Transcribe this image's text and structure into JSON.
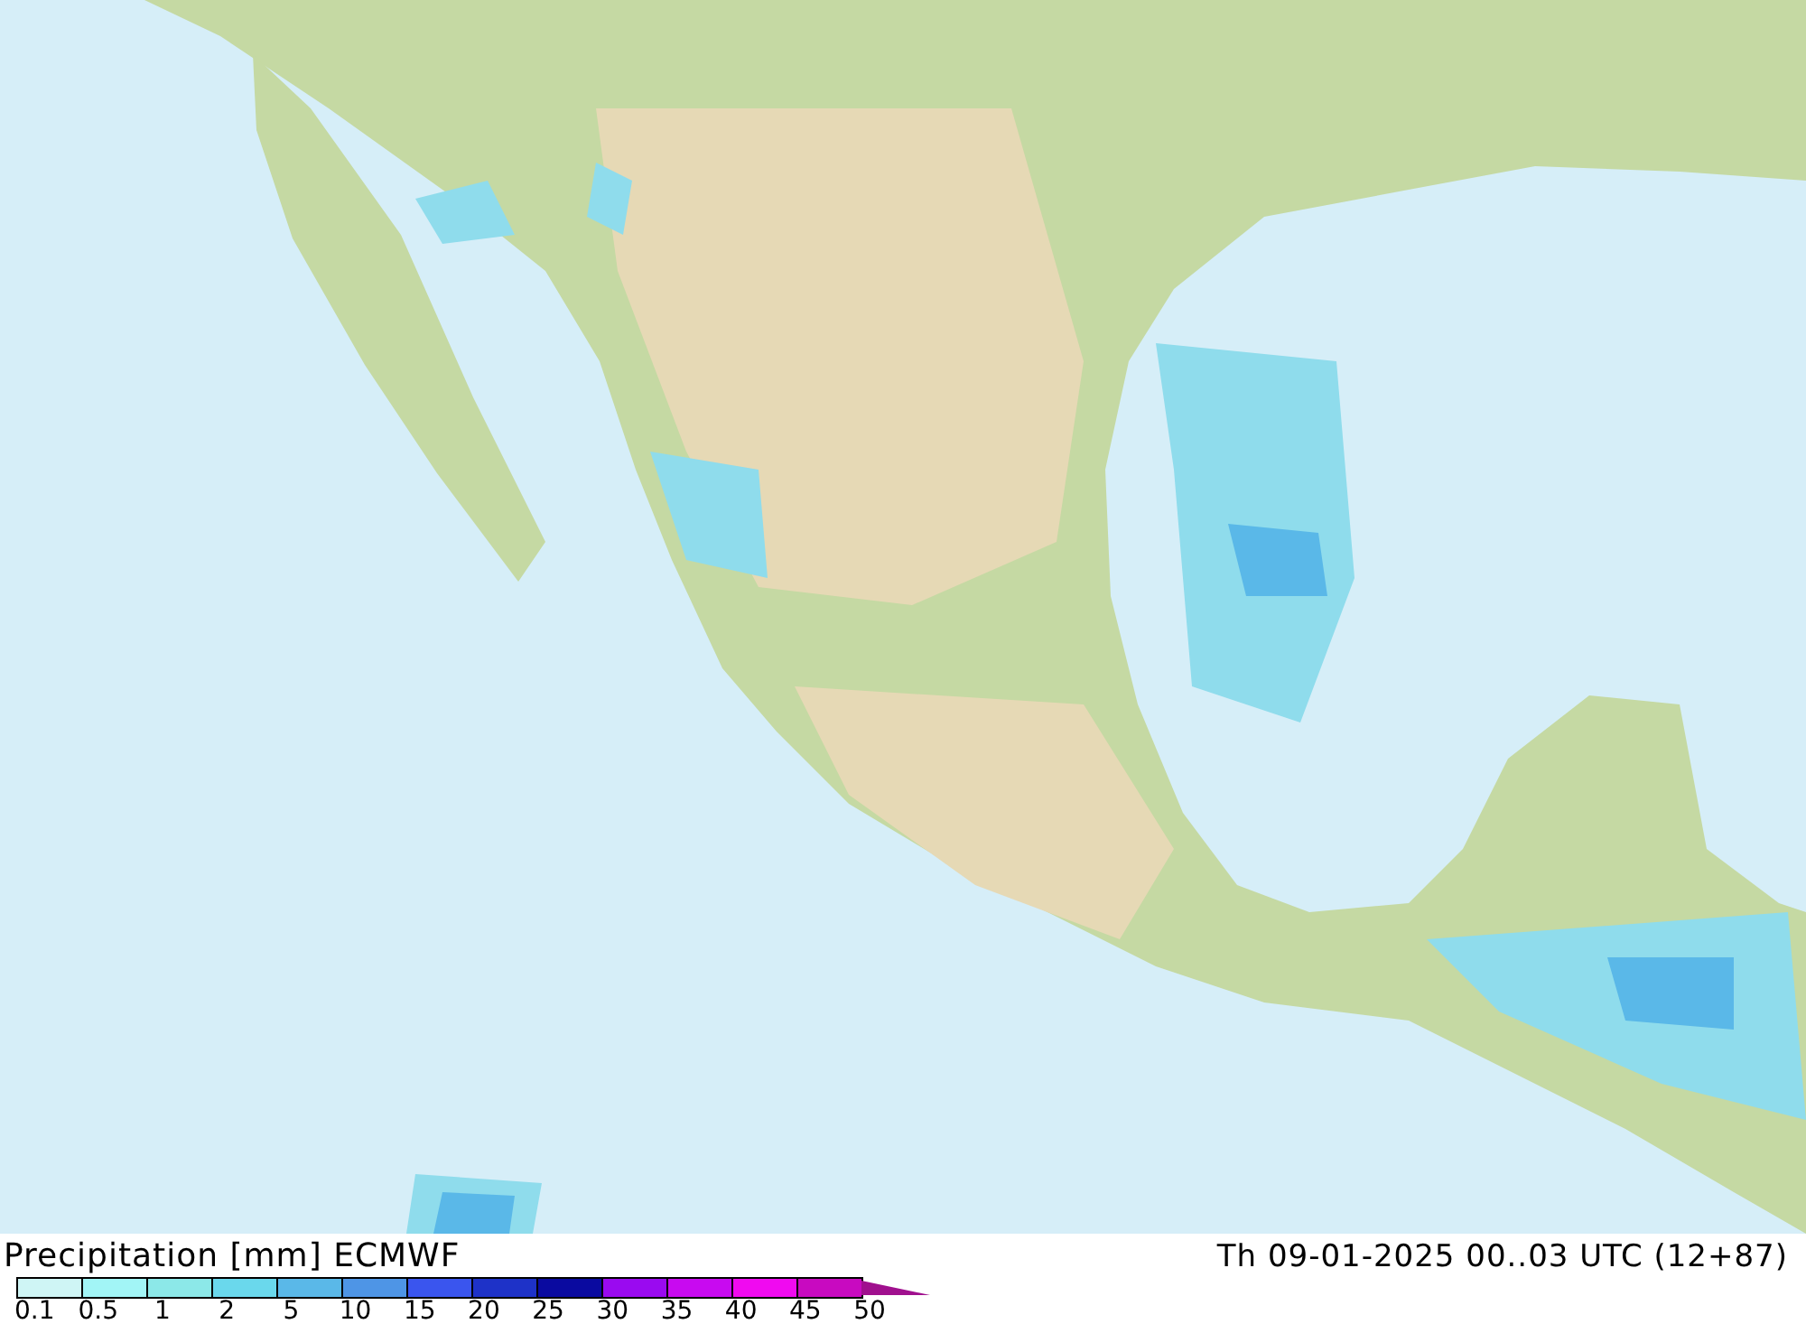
{
  "legend": {
    "title": "Precipitation [mm] ECMWF",
    "valid_time": "Th 09-01-2025 00..03 UTC (12+87)",
    "scale": [
      {
        "kind": "box",
        "color": "#cff5f5"
      },
      {
        "kind": "box",
        "color": "#a2f5f6"
      },
      {
        "kind": "box",
        "color": "#8ce8e8"
      },
      {
        "kind": "box",
        "color": "#6ad8ec"
      },
      {
        "kind": "box",
        "color": "#5ab8e8"
      },
      {
        "kind": "box",
        "color": "#4e95e6"
      },
      {
        "kind": "box",
        "color": "#3a55ee"
      },
      {
        "kind": "box",
        "color": "#1e32c8"
      },
      {
        "kind": "box",
        "color": "#0a0aa0"
      },
      {
        "kind": "box",
        "color": "#9a0af0"
      },
      {
        "kind": "box",
        "color": "#c80af0"
      },
      {
        "kind": "box",
        "color": "#f00af0"
      },
      {
        "kind": "box",
        "color": "#c80ac0"
      },
      {
        "kind": "triangle",
        "color": "#a0108e"
      }
    ],
    "ticks": [
      "0.1",
      "0.5",
      "1",
      "2",
      "5",
      "10",
      "15",
      "20",
      "25",
      "30",
      "35",
      "40",
      "45",
      "50"
    ]
  }
}
